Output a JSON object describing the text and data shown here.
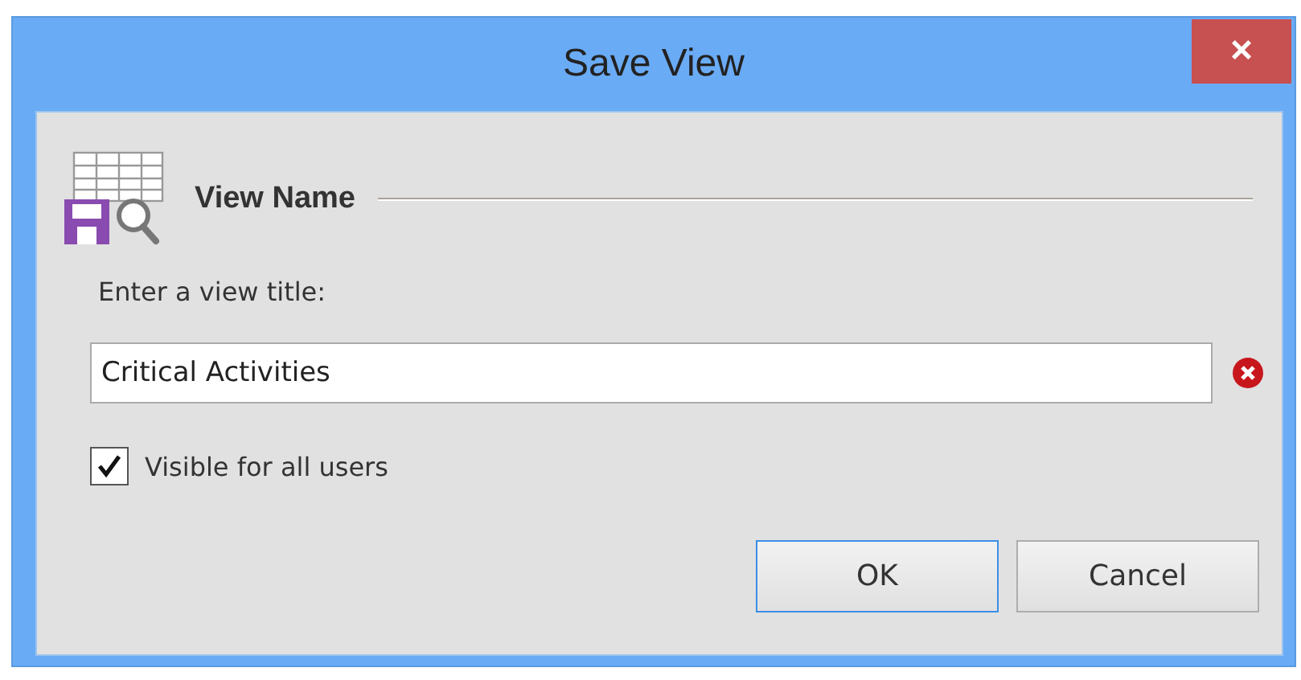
{
  "window": {
    "title": "Save View",
    "close": "×"
  },
  "section": {
    "heading": "View Name"
  },
  "field": {
    "label": "Enter a view title:",
    "value": "Critical Activities",
    "error": true
  },
  "checkbox": {
    "label": "Visible for all users",
    "checked": true
  },
  "buttons": [
    {
      "label": "OK",
      "default": true
    },
    {
      "label": "Cancel",
      "default": false
    }
  ]
}
